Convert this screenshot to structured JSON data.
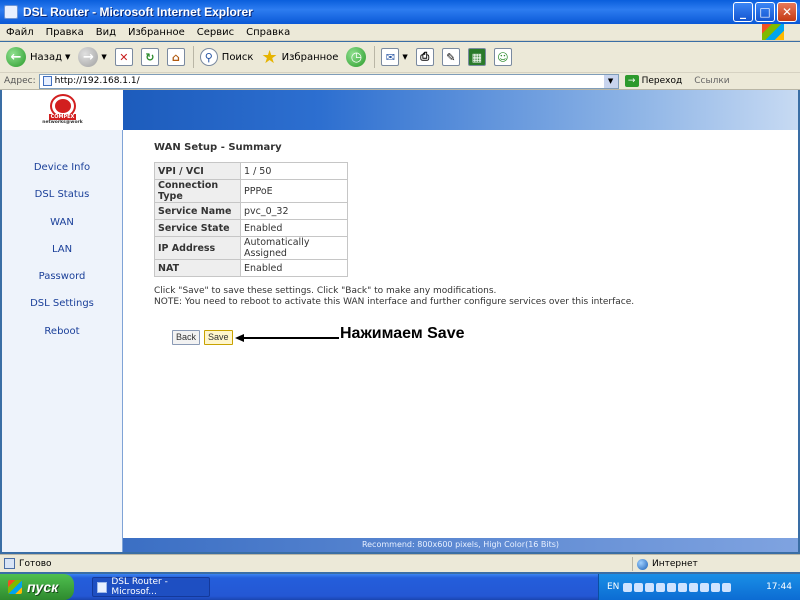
{
  "window": {
    "title": "DSL Router - Microsoft Internet Explorer"
  },
  "menu": [
    "Файл",
    "Правка",
    "Вид",
    "Избранное",
    "Сервис",
    "Справка"
  ],
  "toolbar": {
    "back_label": "Назад",
    "search_label": "Поиск",
    "favorites_label": "Избранное"
  },
  "address": {
    "label": "Адрес:",
    "url": "http://192.168.1.1/",
    "go_label": "Переход",
    "links_label": "Ссылки"
  },
  "brand": {
    "name": "COMPEX",
    "tagline": "networks@work"
  },
  "sidebar": {
    "items": [
      {
        "label": "Device Info"
      },
      {
        "label": "DSL Status"
      },
      {
        "label": "WAN"
      },
      {
        "label": "LAN"
      },
      {
        "label": "Password"
      },
      {
        "label": "DSL Settings"
      },
      {
        "label": "Reboot"
      }
    ]
  },
  "main": {
    "title": "WAN Setup - Summary",
    "rows": [
      {
        "key": "VPI / VCI",
        "value": "1 / 50"
      },
      {
        "key": "Connection Type",
        "value": "PPPoE"
      },
      {
        "key": "Service Name",
        "value": "pvc_0_32"
      },
      {
        "key": "Service State",
        "value": "Enabled"
      },
      {
        "key": "IP Address",
        "value": "Automatically Assigned"
      },
      {
        "key": "NAT",
        "value": "Enabled"
      }
    ],
    "note1": "Click \"Save\" to save these settings. Click \"Back\" to make any modifications.",
    "note2": "NOTE: You need to reboot to activate this WAN interface and further configure services over this interface.",
    "back_label": "Back",
    "save_label": "Save",
    "annotation": "Нажимаем Save",
    "footer": "Recommend: 800x600 pixels, High Color(16 Bits)"
  },
  "status": {
    "text": "Готово",
    "zone": "Интернет"
  },
  "taskbar": {
    "start_label": "пуск",
    "task_label": "DSL Router - Microsof...",
    "lang": "EN",
    "clock": "17:44"
  }
}
